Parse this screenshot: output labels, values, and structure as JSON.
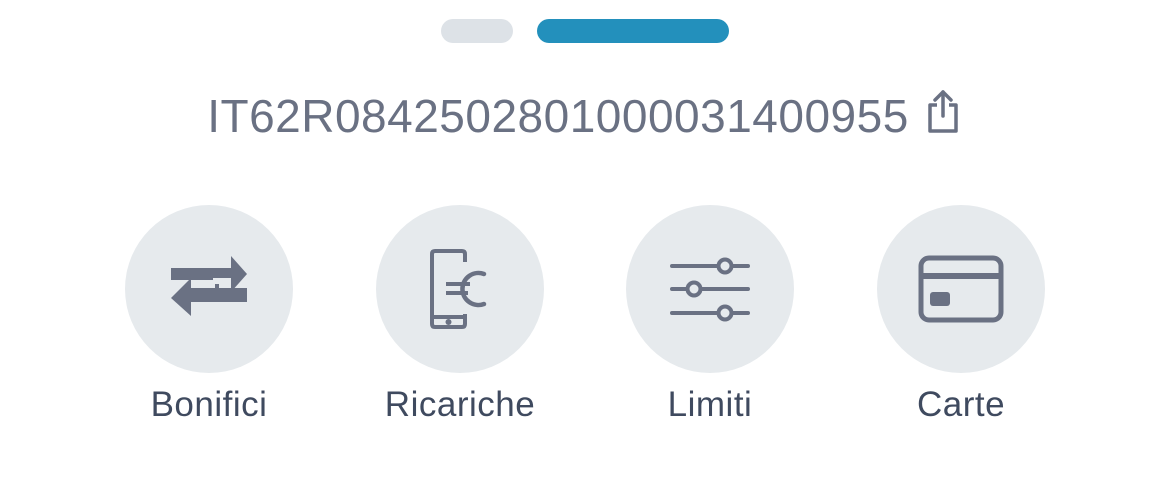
{
  "pager": {
    "pages": 2,
    "active_index": 1
  },
  "account": {
    "iban": "IT62R0842502801000031400955",
    "share_icon": "share-icon"
  },
  "actions": [
    {
      "label": "Bonifici",
      "icon": "transfer-arrows-icon"
    },
    {
      "label": "Ricariche",
      "icon": "phone-euro-icon"
    },
    {
      "label": "Limiti",
      "icon": "sliders-icon"
    },
    {
      "label": "Carte",
      "icon": "credit-card-icon"
    }
  ],
  "colors": {
    "accent": "#2390bc",
    "pager_inactive": "#dde2e7",
    "icon": "#6a7183",
    "circle_bg": "#e6eaed",
    "label": "#3f4a5f"
  }
}
